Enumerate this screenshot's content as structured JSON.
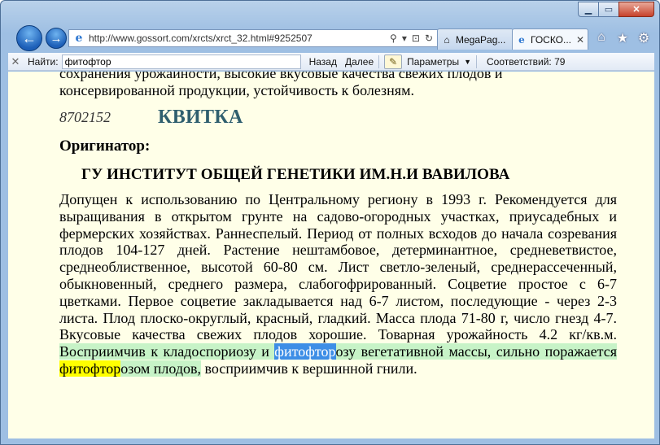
{
  "window": {
    "caption_min": "▁",
    "caption_max": "▭",
    "caption_close": "✕"
  },
  "nav": {
    "back_glyph": "←",
    "forward_glyph": "→",
    "address": "http://www.gossort.com/xrcts/xrct_32.html#9252507",
    "search_glyph": "⚲",
    "dropdown_glyph": "▾",
    "lock_glyph": "⊡",
    "refresh_glyph": "↻",
    "tabs": [
      {
        "label": "MegaPag...",
        "favicon": "⌂",
        "close": ""
      },
      {
        "label": "ГОСКО...",
        "favicon": "e",
        "close": "✕"
      }
    ],
    "home_glyph": "⌂",
    "favorites_glyph": "★",
    "tools_glyph": "⚙"
  },
  "find": {
    "close_glyph": "✕",
    "label": "Найти:",
    "query": "фитофтор",
    "prev": "Назад",
    "next": "Далее",
    "options": "Параметры",
    "matches": "Соответствий: 79"
  },
  "content": {
    "prev_line1": "сохранения урожайности, высокие вкусовые качества свежих плодов и",
    "prev_line2": "консервированной продукции, устойчивость к болезням.",
    "reg_number": "8702152",
    "variety": "КВИТКА",
    "originator_label": "Оригинатор:",
    "originator_name": "ГУ ИНСТИТУТ ОБЩЕЙ ГЕНЕТИКИ ИМ.Н.И ВАВИЛОВА",
    "desc_main": "Допущен к использованию по Центральному региону в 1993 г. Рекомендуется для выращивания в открытом грунте на садово-огородных участках, приусадебных и фермерских хозяйствах. Раннеспелый. Период от полных всходов до начала созревания плодов 104-127 дней. Растение нештамбовое, детерминантное, средневетвистое, среднеоблиственное, высотой 60-80 см. Лист светло-зеленый, среднерассеченный, обыкновенный, среднего размера, слабогофрированный. Соцветие простое с 6-7 цветками. Первое соцветие закладывается над 6-7 листом, последующие - через 2-3 листа. Плод плоско-округлый, красный, гладкий. Масса плода 71-80 г, число гнезд 4-7. Вкусовые качества свежих плодов хорошие. Товарная урожайность 4.2 кг/кв.м.",
    "hl_a": " Восприимчив к кладоспориозу и ",
    "hl_blue": "фитофтор",
    "hl_b": "озу вегетативной массы, сильно поражается ",
    "hl_yellow": "фитофтор",
    "hl_c": "озом плодов,",
    "desc_tail": " восприимчив к вершинной гнили."
  }
}
